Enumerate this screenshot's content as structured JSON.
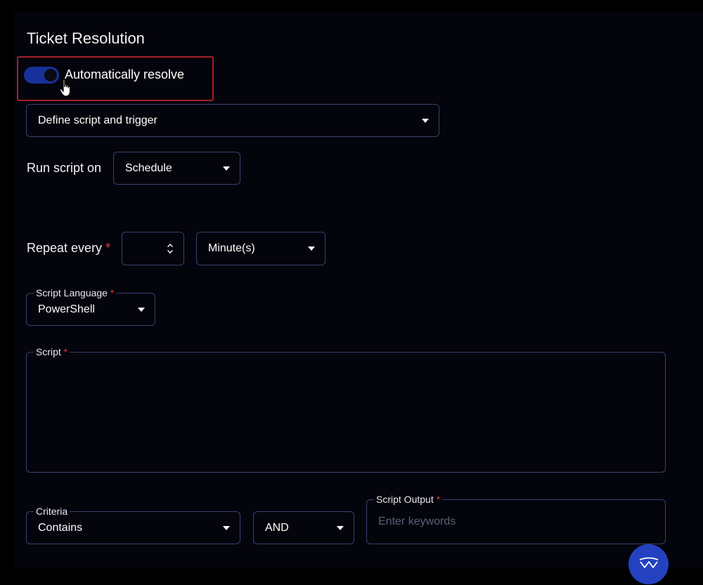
{
  "section": {
    "title": "Ticket Resolution"
  },
  "auto_resolve": {
    "label": "Automatically resolve",
    "enabled": true,
    "accent": "#17319a"
  },
  "mode_select": {
    "value": "Define script and trigger"
  },
  "run_script": {
    "label": "Run script on",
    "value": "Schedule"
  },
  "repeat": {
    "label": "Repeat every",
    "required_mark": "*",
    "number_value": "",
    "unit_value": "Minute(s)"
  },
  "script_language": {
    "label": "Script Language",
    "required_mark": "*",
    "value": "PowerShell"
  },
  "script": {
    "label": "Script",
    "required_mark": "*",
    "value": ""
  },
  "criteria": {
    "label": "Criteria",
    "value": "Contains"
  },
  "operator": {
    "value": "AND"
  },
  "script_output": {
    "label": "Script Output",
    "required_mark": "*",
    "placeholder": "Enter keywords"
  },
  "colors": {
    "background": "#04040c",
    "border": "#3c3f70",
    "required": "#e23b3b",
    "highlight": "#a4202a",
    "fab": "#2441c0"
  },
  "icons": {
    "fab": "assistant-logo-icon",
    "cursor": "hand-pointer-icon"
  }
}
